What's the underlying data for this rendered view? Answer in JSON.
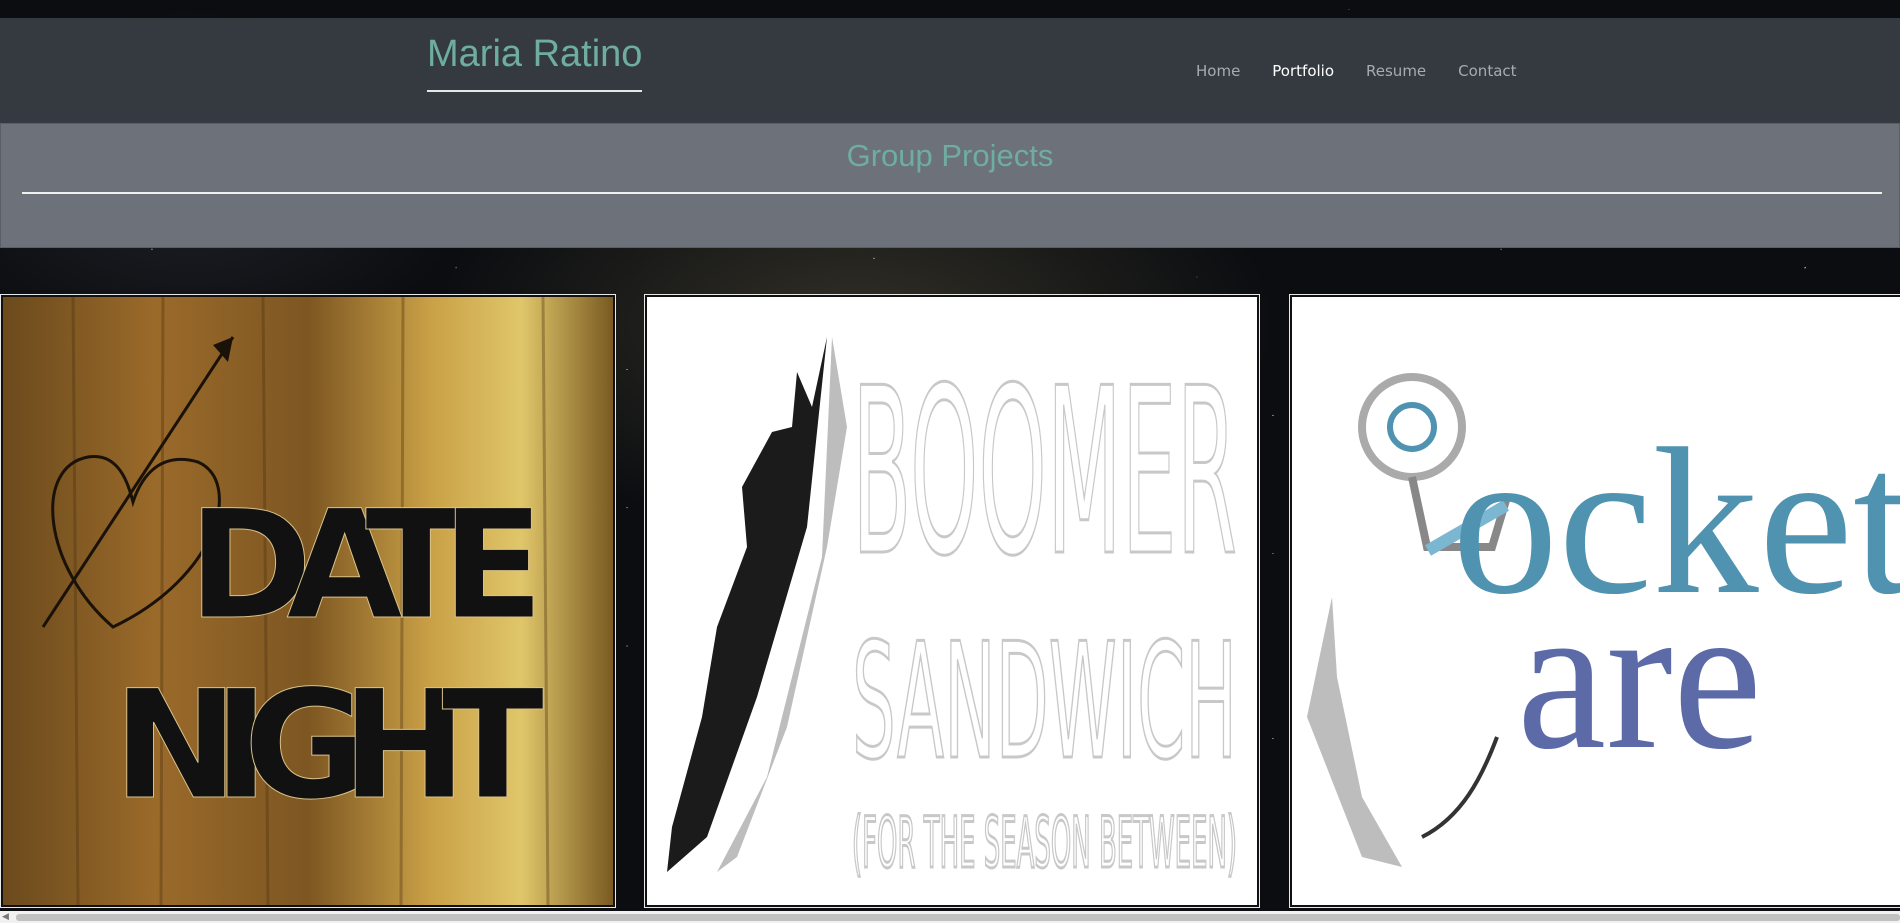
{
  "header": {
    "brand": "Maria Ratino",
    "nav": [
      {
        "label": "Home",
        "active": false
      },
      {
        "label": "Portfolio",
        "active": true
      },
      {
        "label": "Resume",
        "active": false
      },
      {
        "label": "Contact",
        "active": false
      }
    ]
  },
  "section": {
    "title": "Group Projects"
  },
  "projects": [
    {
      "image_text": [
        "DATE",
        "NIGHT"
      ]
    },
    {
      "image_text": [
        "BOOMER",
        "SANDWICH",
        "(FOR THE SEASON BETWEEN)"
      ]
    },
    {
      "image_text": [
        "ocket",
        "are"
      ]
    }
  ],
  "colors": {
    "navbar_bg": "#343a40",
    "accent_teal": "#6fada0",
    "section_bg": "#6c717a"
  },
  "icons": {
    "scroll_left": "chevron-left-icon"
  }
}
